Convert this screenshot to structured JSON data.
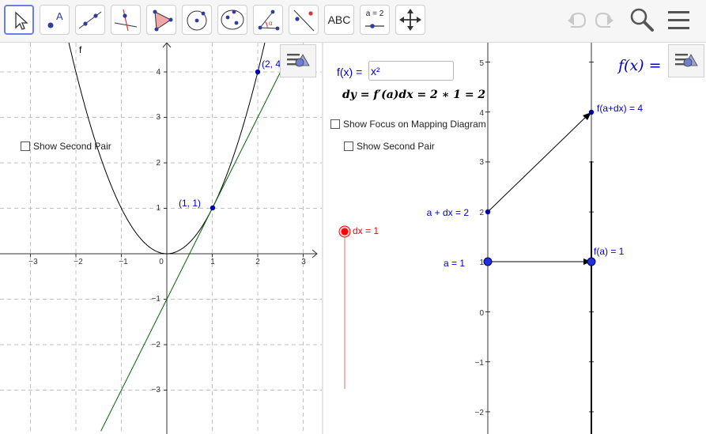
{
  "toolbar": {
    "tools": [
      {
        "name": "move-tool",
        "icon": "arrow-cursor-icon"
      },
      {
        "name": "point-tool",
        "icon": "point-icon"
      },
      {
        "name": "line-tool",
        "icon": "line-through-points-icon"
      },
      {
        "name": "perpendicular-tool",
        "icon": "perpendicular-line-icon"
      },
      {
        "name": "polygon-tool",
        "icon": "polygon-icon"
      },
      {
        "name": "circle-tool",
        "icon": "circle-center-point-icon"
      },
      {
        "name": "conic-tool",
        "icon": "ellipse-icon"
      },
      {
        "name": "angle-tool",
        "icon": "angle-icon"
      },
      {
        "name": "reflect-tool",
        "icon": "reflect-about-line-icon"
      },
      {
        "name": "text-tool",
        "label": "ABC"
      },
      {
        "name": "slider-tool",
        "label": "a = 2"
      },
      {
        "name": "move-graphics-view-tool",
        "icon": "move-view-icon"
      }
    ],
    "selected_tool": "move-tool",
    "right_icons": [
      "undo-icon",
      "redo-icon",
      "search-icon",
      "menu-icon"
    ]
  },
  "graphics1": {
    "axis_ticks_x": [
      "−3",
      "−2",
      "−1",
      "0",
      "1",
      "2",
      "3"
    ],
    "axis_ticks_y": [
      "4",
      "3",
      "2",
      "1",
      "−1",
      "−2",
      "−3"
    ],
    "curve_label": "f",
    "point_a_label": "(1, 1)",
    "point_b_label": "(2, 4)",
    "checkbox_label": "Show Second Pair",
    "curve_color": "#000000",
    "tangent_color": "#006400"
  },
  "graphics2": {
    "input_label": "f(x) =",
    "input_value": "x²",
    "formula": "dy = f′(a)dx = 2 ∗ 1 = 2",
    "checkbox_focus_label": "Show Focus on Mapping Diagram",
    "checkbox_second_label": "Show Second Pair",
    "slider_label": "dx = 1",
    "slider_color": "#ff0000",
    "label_a_dx": "a + dx = 2",
    "label_a": "a = 1",
    "label_fadx": "f(a+dx) = 4",
    "label_fa": "f(a) = 1",
    "corner_formula": "f(x) =",
    "axis_ticks_y": [
      "5",
      "4",
      "3",
      "2",
      "1",
      "0",
      "−1",
      "−2"
    ],
    "point_color": "#0000cc"
  }
}
